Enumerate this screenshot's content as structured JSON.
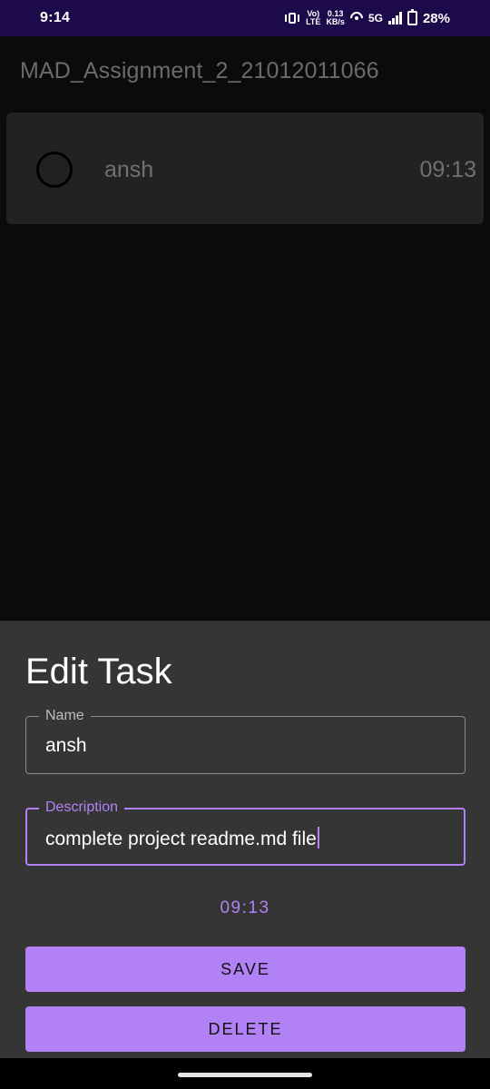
{
  "status_bar": {
    "time": "9:14",
    "volte_top": "Vo)",
    "volte_bottom": "LTE",
    "speed_value": "0.13",
    "speed_unit": "KB/s",
    "network": "5G",
    "battery_percent": "28%",
    "background_color": "#1c0a4a"
  },
  "app_bar": {
    "title": "MAD_Assignment_2_21012011066"
  },
  "tasks": [
    {
      "name": "ansh",
      "time": "09:13",
      "completed": false
    }
  ],
  "edit_sheet": {
    "title": "Edit Task",
    "name_label": "Name",
    "name_value": "ansh",
    "description_label": "Description",
    "description_value": "complete project readme.md file",
    "time": "09:13",
    "save_label": "SAVE",
    "delete_label": "DELETE",
    "accent_color": "#b381f6"
  }
}
